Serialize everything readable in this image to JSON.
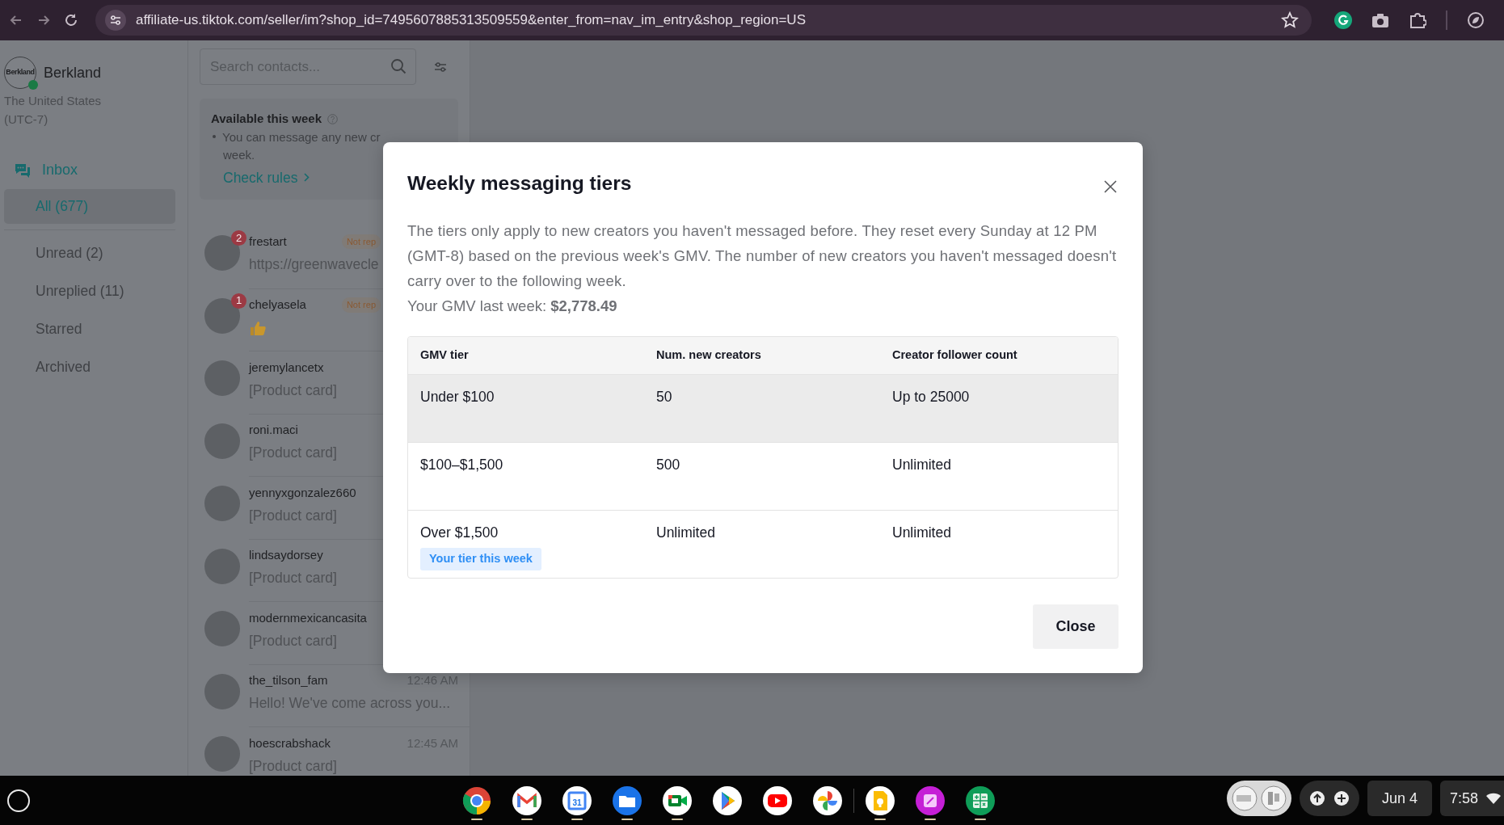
{
  "browser": {
    "url": "affiliate-us.tiktok.com/seller/im?shop_id=7495607885313509559&enter_from=nav_im_entry&shop_region=US",
    "bookmarked": false
  },
  "shop": {
    "logo_text": "Berkland",
    "name": "Berkland",
    "online": true,
    "region": "The United States",
    "timezone": "(UTC-7)"
  },
  "nav": {
    "title": "Inbox",
    "items": [
      {
        "label": "All (677)",
        "selected": true
      },
      {
        "label": "Unread (2)",
        "selected": false
      },
      {
        "label": "Unreplied (11)",
        "selected": false
      },
      {
        "label": "Starred",
        "selected": false
      },
      {
        "label": "Archived",
        "selected": false
      }
    ]
  },
  "search": {
    "placeholder": "Search contacts..."
  },
  "weekly_card": {
    "title": "Available this week",
    "lines": [
      "You can message any new cr",
      "week."
    ],
    "link": "Check rules"
  },
  "contacts": [
    {
      "kind": "text",
      "name": "frestart",
      "preview": "https://greenwavecle",
      "unread": "2",
      "tag": "Not rep"
    },
    {
      "kind": "thumbs",
      "name": "chelyasela",
      "unread": "1",
      "tag": "Not rep"
    },
    {
      "kind": "text",
      "name": "jeremylancetx",
      "preview": "[Product card]"
    },
    {
      "kind": "text",
      "name": "roni.maci",
      "preview": "[Product card]"
    },
    {
      "kind": "text",
      "name": "yennyxgonzalez660",
      "preview": "[Product card]"
    },
    {
      "kind": "text",
      "name": "lindsaydorsey",
      "preview": "[Product card]"
    },
    {
      "kind": "text",
      "name": "modernmexicancasita",
      "preview": "[Product card]"
    },
    {
      "kind": "text",
      "name": "the_tilson_fam",
      "preview": "Hello! We've come across you...",
      "time": "12:46 AM"
    },
    {
      "kind": "text",
      "name": "hoescrabshack",
      "preview": "[Product card]",
      "time": "12:45 AM"
    }
  ],
  "modal": {
    "title": "Weekly messaging tiers",
    "description": "The tiers only apply to new creators you haven't messaged before. They reset every Sunday at 12 PM (GMT-8) based on the previous week's GMV. The number of new creators you haven't messaged doesn't carry over to the following week.",
    "gmv_line": "Your GMV last week: **$2,778.49**",
    "table": {
      "columns": [
        "GMV tier",
        "Num. new creators",
        "Creator follower count"
      ],
      "rows": [
        {
          "cells": [
            "Under $100",
            "50",
            "Up to 25000"
          ],
          "highlighted": true
        },
        {
          "cells": [
            "$100–$1,500",
            "500",
            "Unlimited"
          ],
          "highlighted": false
        },
        {
          "cells": [
            "Over $1,500",
            "Unlimited",
            "Unlimited"
          ],
          "highlighted": false,
          "badge": "Your tier this week"
        }
      ]
    },
    "close_button": "Close"
  },
  "taskbar": {
    "apps": [
      {
        "kind": "chrome",
        "running": true
      },
      {
        "kind": "gmail",
        "running": true
      },
      {
        "kind": "calendar",
        "label": "31",
        "running": true
      },
      {
        "kind": "files",
        "running": true
      },
      {
        "kind": "meet",
        "running": true
      },
      {
        "kind": "play",
        "running": false
      },
      {
        "kind": "youtube",
        "running": false
      },
      {
        "kind": "photos",
        "running": false
      },
      {
        "kind": "keep",
        "running": true
      },
      {
        "kind": "canvas",
        "running": true
      },
      {
        "kind": "sheets",
        "running": true
      }
    ],
    "date": "Jun 4",
    "time": "7:58"
  }
}
